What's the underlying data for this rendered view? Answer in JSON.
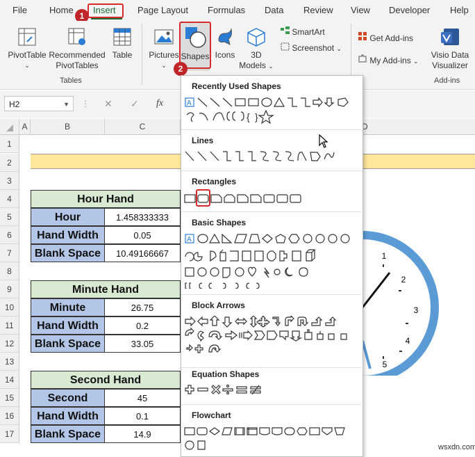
{
  "menu": [
    "File",
    "Home",
    "Insert",
    "Page Layout",
    "Formulas",
    "Data",
    "Review",
    "View",
    "Developer",
    "Help"
  ],
  "ribbon": {
    "pivottable": "PivotTable",
    "recommended_1": "Recommended",
    "recommended_2": "PivotTables",
    "table": "Table",
    "tables_group": "Tables",
    "pictures": "Pictures",
    "shapes": "Shapes",
    "icons": "Icons",
    "models_1": "3D",
    "models_2": "Models",
    "smartart": "SmartArt",
    "screenshot": "Screenshot",
    "get_addins": "Get Add-ins",
    "my_addins": "My Add-ins",
    "visio_1": "Visio Data",
    "visio_2": "Visualizer",
    "addins_group": "Add-ins"
  },
  "formula_bar": {
    "name_box": "H2",
    "fx": "fx"
  },
  "columns": [
    "A",
    "B",
    "C",
    "D"
  ],
  "rows": [
    "1",
    "2",
    "3",
    "4",
    "5",
    "6",
    "7",
    "8",
    "9",
    "10",
    "11",
    "12",
    "13",
    "14",
    "15",
    "16",
    "17"
  ],
  "tables": [
    {
      "title": "Hour Hand",
      "rows": [
        {
          "label": "Hour",
          "value": "1.458333333"
        },
        {
          "label": "Hand Width",
          "value": "0.05"
        },
        {
          "label": "Blank Space",
          "value": "10.49166667"
        }
      ]
    },
    {
      "title": "Minute Hand",
      "rows": [
        {
          "label": "Minute",
          "value": "26.75"
        },
        {
          "label": "Hand Width",
          "value": "0.2"
        },
        {
          "label": "Blank Space",
          "value": "33.05"
        }
      ]
    },
    {
      "title": "Second Hand",
      "rows": [
        {
          "label": "Second",
          "value": "45"
        },
        {
          "label": "Hand Width",
          "value": "0.1"
        },
        {
          "label": "Blank Space",
          "value": "14.9"
        }
      ]
    }
  ],
  "dropdown": {
    "recently_used": "Recently Used Shapes",
    "lines": "Lines",
    "rectangles": "Rectangles",
    "basic": "Basic Shapes",
    "block_arrows": "Block Arrows",
    "equation": "Equation Shapes",
    "flowchart": "Flowchart"
  },
  "clock": {
    "numbers": [
      "1",
      "2",
      "3",
      "4",
      "5"
    ]
  },
  "steps": [
    "1",
    "2"
  ],
  "watermark": "wsxdn.com",
  "colors": {
    "accent_red": "#c0252a",
    "table_header": "#d9ead3",
    "table_label": "#b4c6e7",
    "title_band": "#ffe699",
    "clock_ring": "#5b9bd5"
  }
}
